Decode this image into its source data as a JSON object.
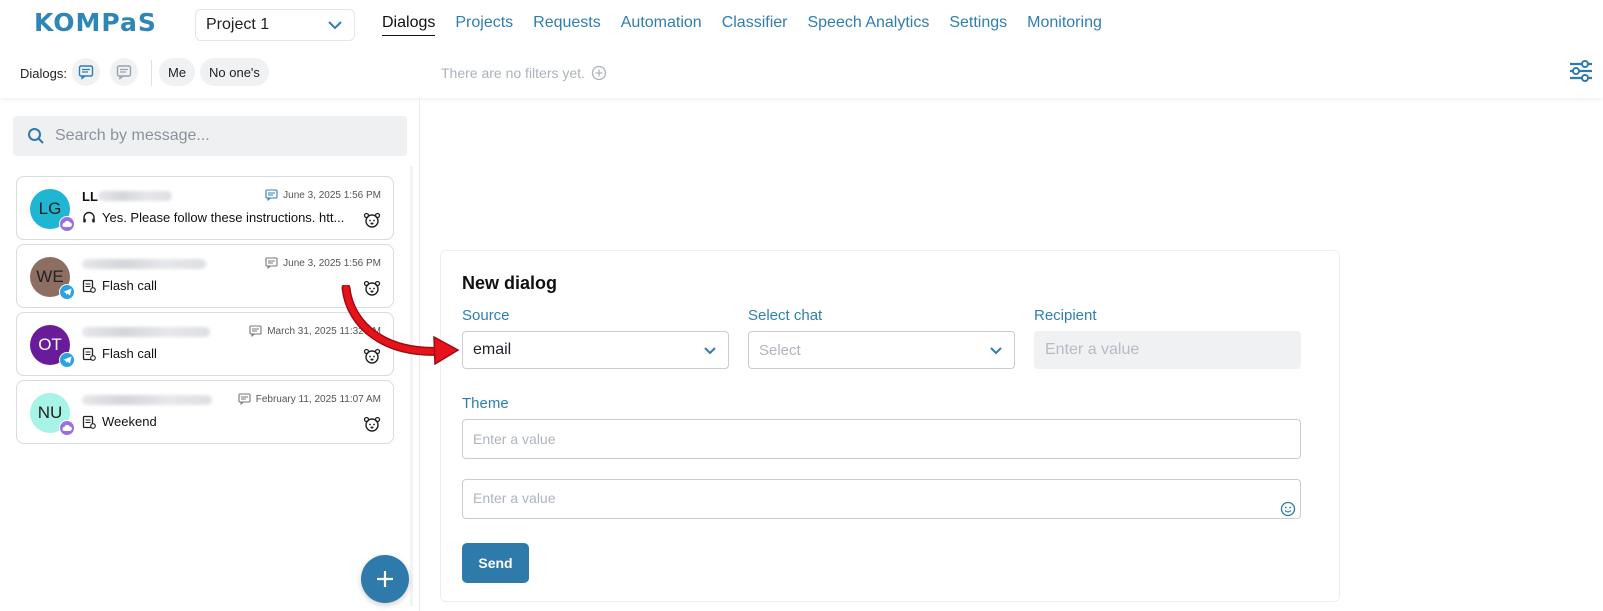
{
  "header": {
    "logo": "KOMPaS",
    "project_selector": "Project 1",
    "nav": [
      "Dialogs",
      "Projects",
      "Requests",
      "Automation",
      "Classifier",
      "Speech Analytics",
      "Settings",
      "Monitoring"
    ],
    "active_nav": "Dialogs"
  },
  "subbar": {
    "dialogs_label": "Dialogs:",
    "chip_me": "Me",
    "chip_none": "No one's",
    "no_filters": "There are no filters yet."
  },
  "sidebar": {
    "search_placeholder": "Search by message...",
    "dialogs": [
      {
        "initials": "LG",
        "name_visible": "LL",
        "date": "June 3, 2025 1:56 PM",
        "message": "Yes. Please follow these instructions. htt...",
        "avatar_color": "#1eb6d1",
        "channel": "cloud",
        "msg_icon": "headset-icon"
      },
      {
        "initials": "WE",
        "name_visible": "",
        "date": "June 3, 2025 1:56 PM",
        "message": "Flash call",
        "avatar_color": "#8d6e63",
        "channel": "telegram",
        "msg_icon": "document-icon"
      },
      {
        "initials": "OT",
        "name_visible": "",
        "date": "March 31, 2025 11:32 AM",
        "message": "Flash call",
        "avatar_color": "#6a1b9a",
        "channel": "telegram",
        "msg_icon": "document-icon"
      },
      {
        "initials": "NU",
        "name_visible": "",
        "date": "February 11, 2025 11:07 AM",
        "message": "Weekend",
        "avatar_color": "#a7f3e8",
        "channel": "cloud",
        "msg_icon": "document-icon"
      }
    ]
  },
  "new_dialog": {
    "title": "New dialog",
    "source_label": "Source",
    "source_value": "email",
    "chat_label": "Select chat",
    "chat_placeholder": "Select",
    "recipient_label": "Recipient",
    "recipient_placeholder": "Enter a value",
    "theme_label": "Theme",
    "theme_placeholder": "Enter a value",
    "message_placeholder": "Enter a value",
    "send_label": "Send"
  },
  "colors": {
    "accent": "#2e7aab",
    "link": "#2e7fb0",
    "annotation_arrow": "#e8121b"
  }
}
